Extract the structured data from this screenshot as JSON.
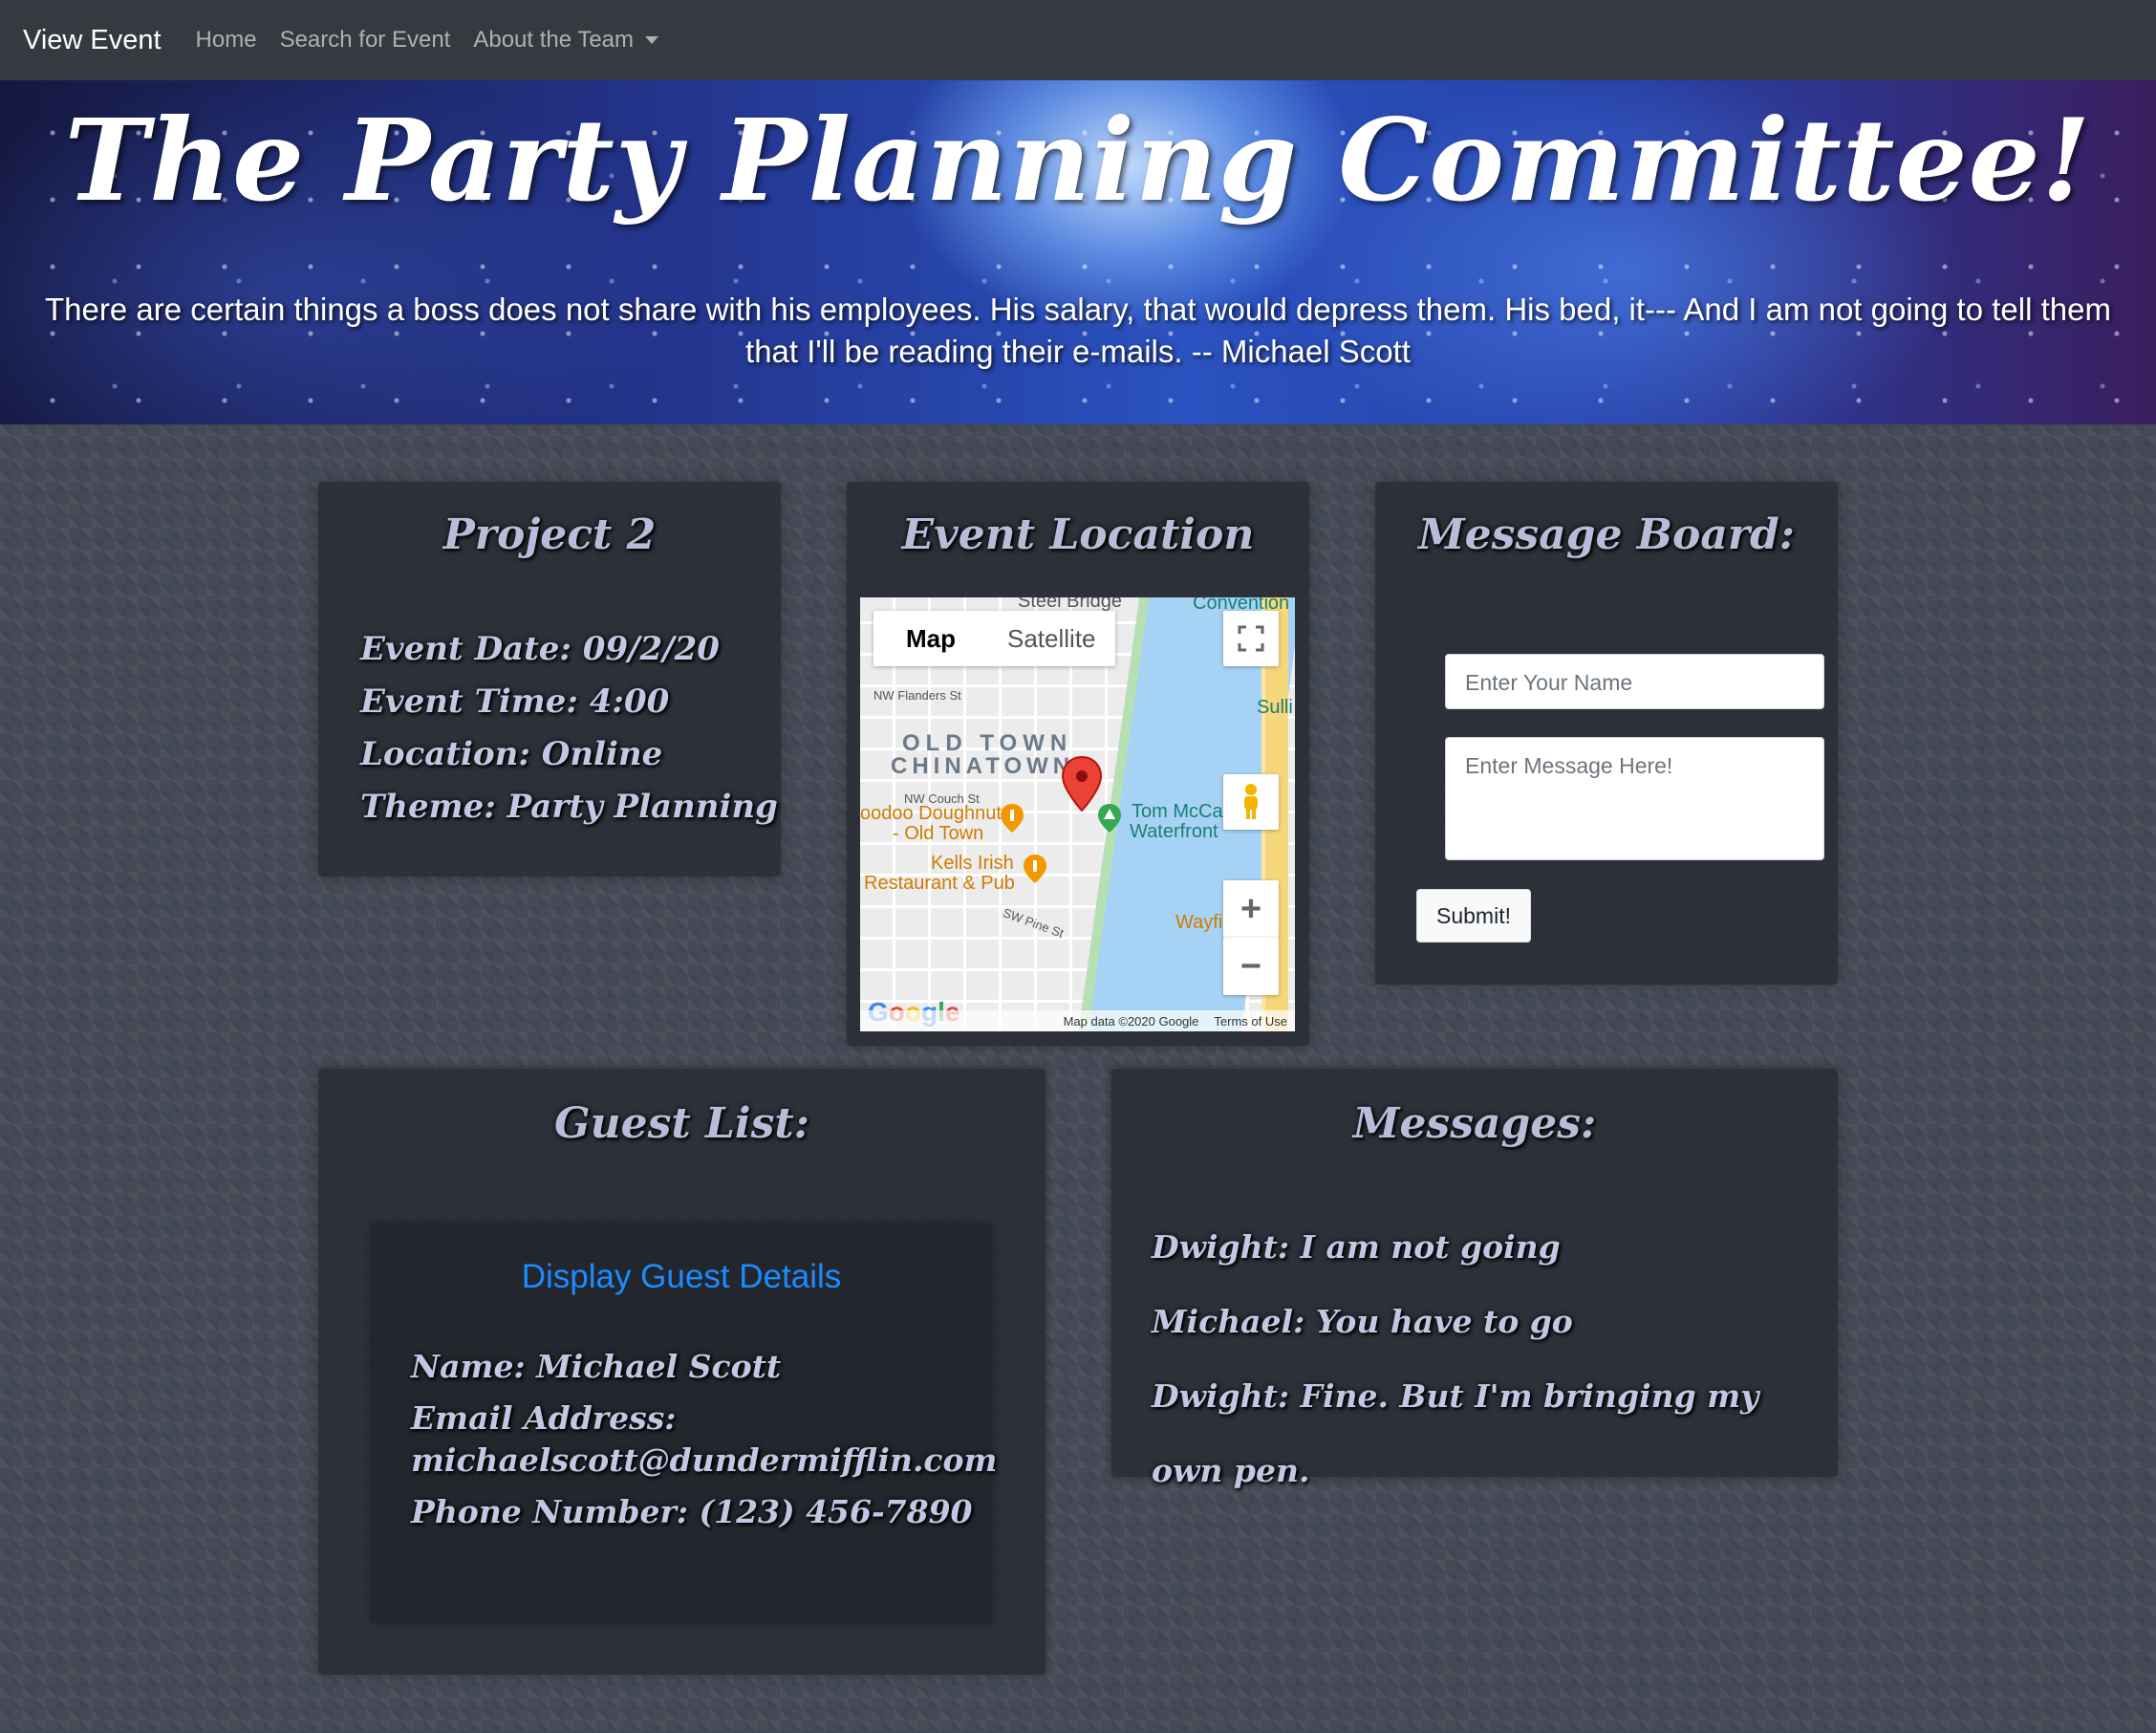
{
  "navbar": {
    "brand": "View Event",
    "links": [
      "Home",
      "Search for Event",
      "About the Team"
    ]
  },
  "hero": {
    "title": "The Party Planning Committee!",
    "quote": "There are certain things a boss does not share with his employees. His salary, that would depress them. His bed, it--- And I am not going to tell them that I'll be reading their e-mails. -- Michael Scott"
  },
  "event": {
    "title": "Project 2",
    "details": [
      "Event Date: 09/2/20",
      "Event Time: 4:00",
      "Location: Online",
      "Theme: Party Planning"
    ]
  },
  "location": {
    "title": "Event Location",
    "map": {
      "type_map": "Map",
      "type_satellite": "Satellite",
      "labels": {
        "steel_bridge": "Steel Bridge",
        "convention": "Convention",
        "flanders": "NW Flanders St",
        "old_town": "OLD TOWN",
        "chinatown": "CHINATOWN",
        "couch": "NW Couch St",
        "voodoo": "oodoo Doughnut",
        "voodoo2": "- Old Town",
        "tom": "Tom McCa",
        "waterfront": "Waterfront",
        "kells": "Kells Irish",
        "kells2": "Restaurant & Pub",
        "pine": "SW Pine St",
        "wayfi": "Wayfi",
        "sulli": "Sulli"
      },
      "footer_data": "Map data ©2020 Google",
      "footer_terms": "Terms of Use",
      "google": "Google"
    }
  },
  "message_board": {
    "title": "Message Board:",
    "name_placeholder": "Enter Your Name",
    "message_placeholder": "Enter   Message Here!",
    "submit": "Submit!"
  },
  "guest_list": {
    "title": "Guest List:",
    "inner_title": "Display Guest Details",
    "name": "Name: Michael Scott",
    "email_label": "Email Address:",
    "email": "michaelscott@dundermifflin.com",
    "phone": "Phone Number:  (123) 456-7890"
  },
  "messages": {
    "title": "Messages:",
    "items": [
      "Dwight: I am not going",
      "Michael: You have to go",
      "Dwight: Fine. But I'm bringing my own pen."
    ]
  },
  "colors": {
    "navbar": "#343a40",
    "accent_link": "#1a8cff",
    "script_text": "#c5c6e4",
    "map_pin": "#ea4335"
  }
}
